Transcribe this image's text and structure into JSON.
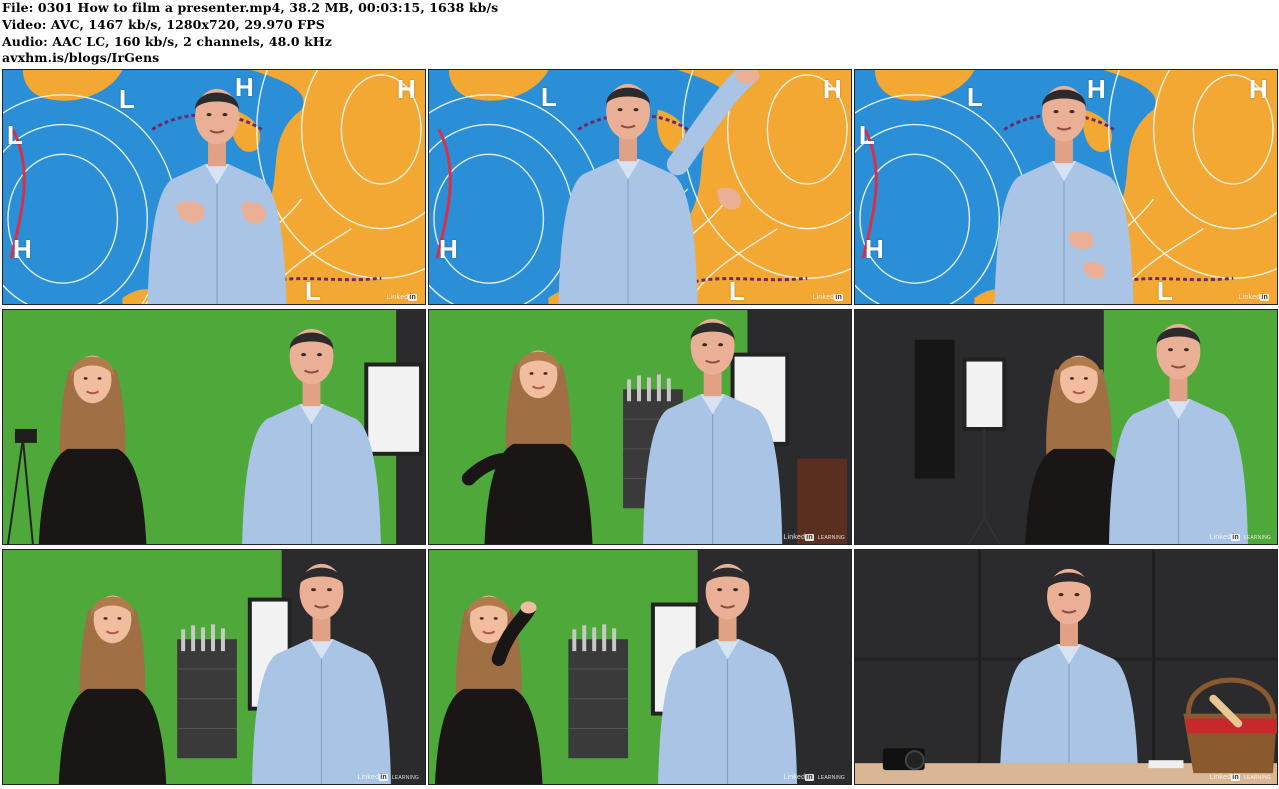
{
  "header": {
    "file_line": "File: 0301 How to film a presenter.mp4, 38.2 MB, 00:03:15, 1638 kb/s",
    "video_line": "Video: AVC, 1467 kb/s, 1280x720, 29.970 FPS",
    "audio_line": "Audio: AAC LC, 160 kb/s, 2 channels, 48.0 kHz",
    "site_line": "avxhm.is/blogs/IrGens"
  },
  "watermark": {
    "prefix": "Linked",
    "badge": "in",
    "suffix": "LEARNING"
  },
  "map_labels": [
    "H",
    "L",
    "H",
    "L",
    "H",
    "L",
    "L"
  ],
  "colors": {
    "ocean": "#2a8fd6",
    "land": "#f2a833",
    "green_screen": "#4ea83a",
    "studio_dark": "#2b2b2e",
    "shirt": "#a9c4e4"
  },
  "thumbnails": [
    {
      "scene": "weather-map-presenter"
    },
    {
      "scene": "weather-map-presenter-pointing"
    },
    {
      "scene": "weather-map-presenter-gesturing"
    },
    {
      "scene": "green-screen-duo"
    },
    {
      "scene": "green-screen-duo-discussion"
    },
    {
      "scene": "studio-duo-softbox"
    },
    {
      "scene": "green-screen-duo-talking"
    },
    {
      "scene": "green-screen-duo-wave"
    },
    {
      "scene": "dark-studio-presenter-table"
    }
  ]
}
